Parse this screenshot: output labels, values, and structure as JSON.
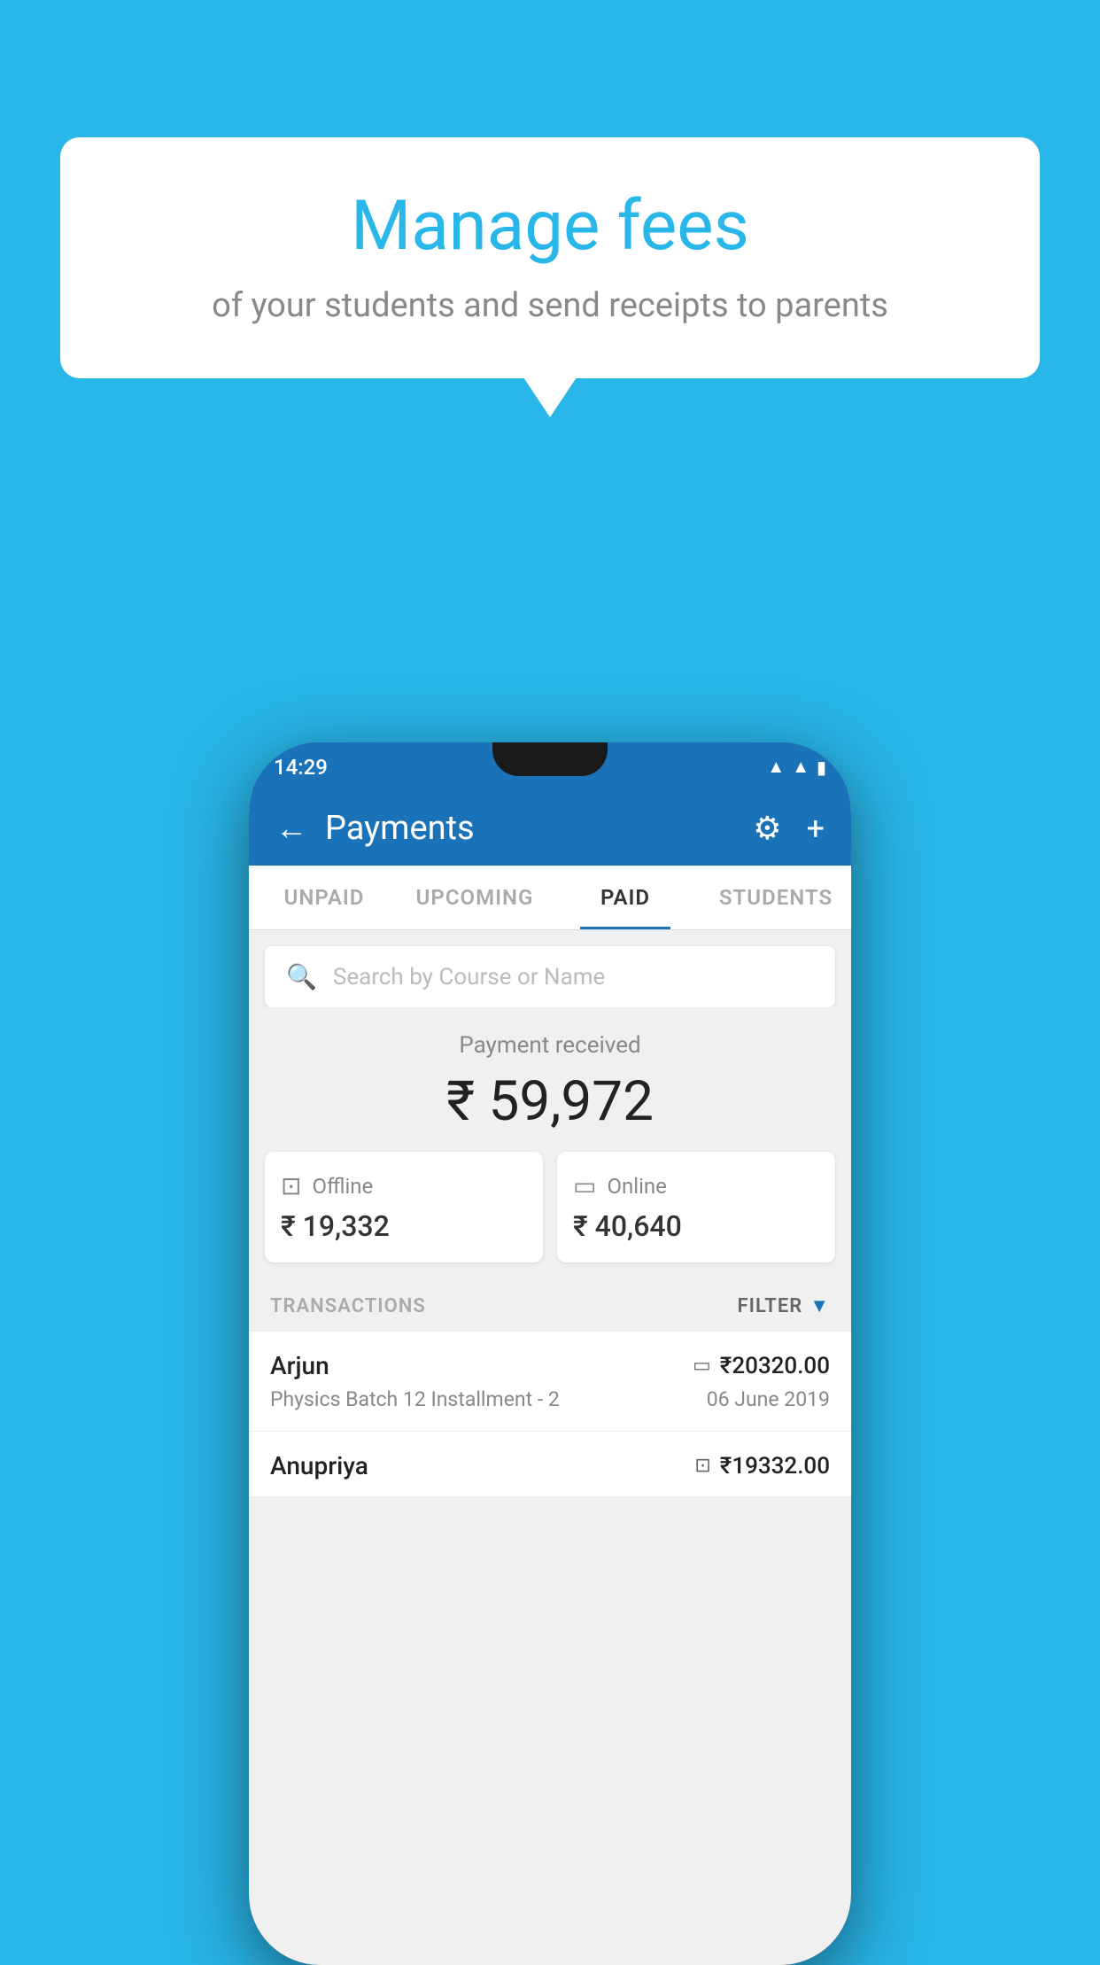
{
  "background_color": "#29b6e8",
  "bubble": {
    "title": "Manage fees",
    "subtitle": "of your students and send receipts to parents"
  },
  "phone": {
    "status_bar": {
      "time": "14:29"
    },
    "header": {
      "title": "Payments",
      "back_label": "←",
      "settings_icon": "⚙",
      "add_icon": "+"
    },
    "tabs": [
      {
        "label": "UNPAID",
        "active": false
      },
      {
        "label": "UPCOMING",
        "active": false
      },
      {
        "label": "PAID",
        "active": true
      },
      {
        "label": "STUDENTS",
        "active": false
      }
    ],
    "search": {
      "placeholder": "Search by Course or Name"
    },
    "payment_summary": {
      "label": "Payment received",
      "amount": "₹ 59,972",
      "offline_label": "Offline",
      "offline_amount": "₹ 19,332",
      "online_label": "Online",
      "online_amount": "₹ 40,640"
    },
    "transactions": {
      "header_label": "TRANSACTIONS",
      "filter_label": "FILTER",
      "rows": [
        {
          "name": "Arjun",
          "amount": "₹20320.00",
          "payment_type": "online",
          "course": "Physics Batch 12 Installment - 2",
          "date": "06 June 2019"
        },
        {
          "name": "Anupriya",
          "amount": "₹19332.00",
          "payment_type": "offline",
          "course": "",
          "date": ""
        }
      ]
    }
  }
}
